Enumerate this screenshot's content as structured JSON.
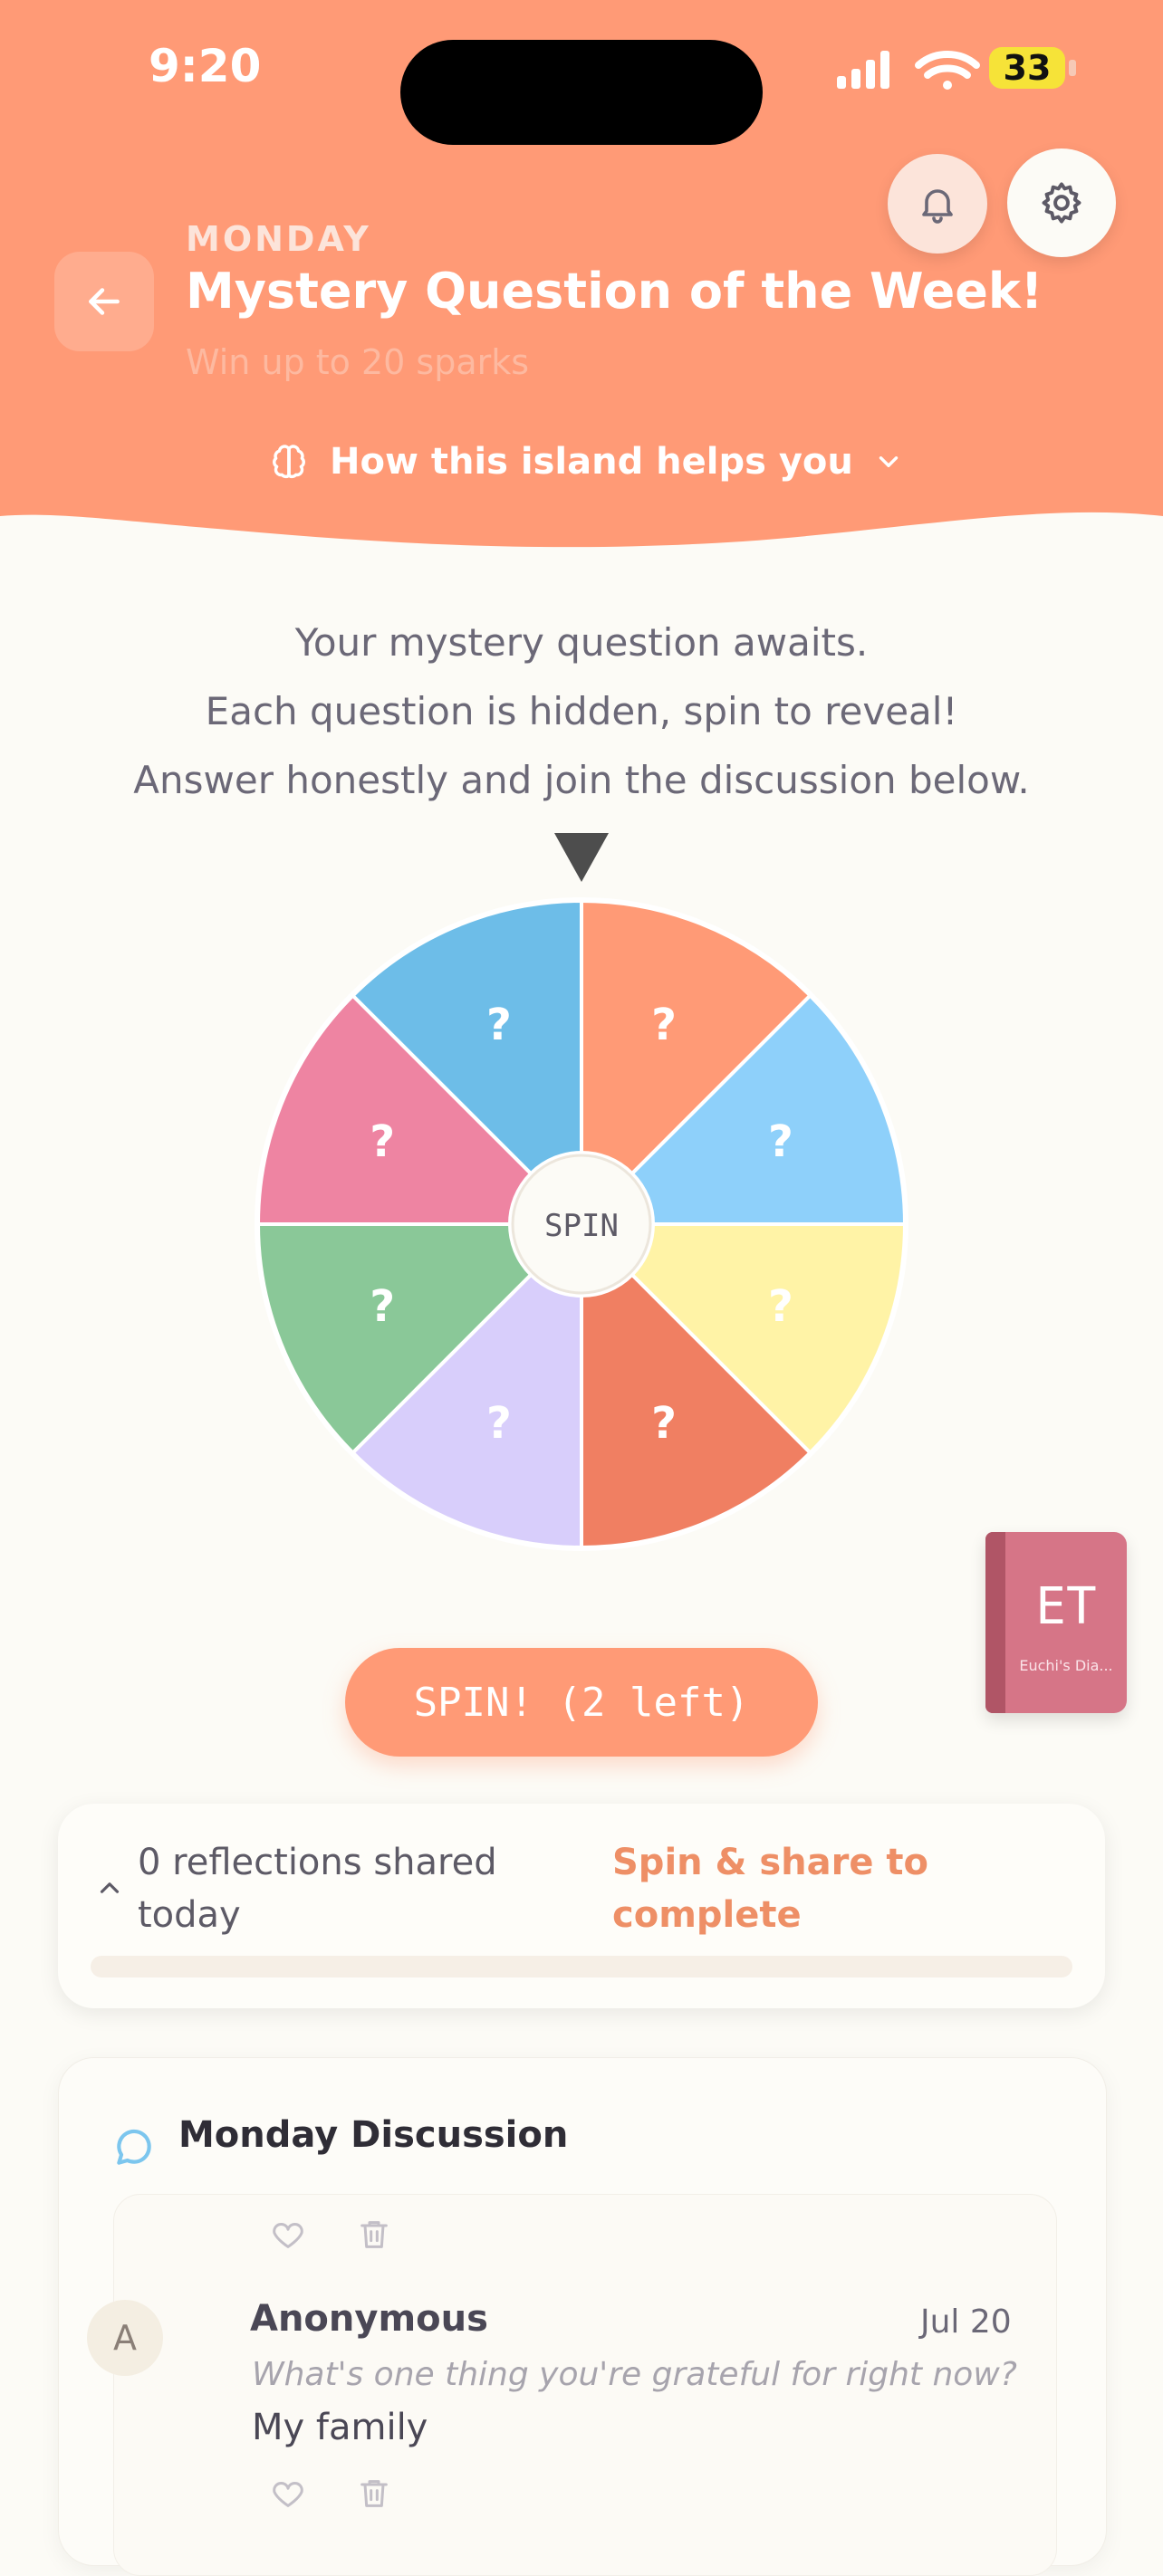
{
  "status_bar": {
    "time": "9:20",
    "battery": "33"
  },
  "header": {
    "day": "MONDAY",
    "title": "Mystery Question of the Week!",
    "subtitle": "Win up to 20 sparks",
    "helps_label": "How this island helps you",
    "accent_color": "#FF9A76"
  },
  "intro": {
    "lines": [
      "Your mystery question awaits.",
      "Each question is hidden, spin to reveal!",
      "Answer honestly and join the discussion below."
    ]
  },
  "wheel": {
    "center_label": "SPIN",
    "segments": [
      {
        "label": "?",
        "color": "#FF9A76"
      },
      {
        "label": "?",
        "color": "#8ED0FA"
      },
      {
        "label": "?",
        "color": "#FFF3A6"
      },
      {
        "label": "?",
        "color": "#F07F62"
      },
      {
        "label": "?",
        "color": "#D8CEFB"
      },
      {
        "label": "?",
        "color": "#8AC898"
      },
      {
        "label": "?",
        "color": "#EE84A2"
      },
      {
        "label": "?",
        "color": "#6DBDE8"
      }
    ]
  },
  "spin_button": {
    "label": "SPIN! (2 left)"
  },
  "book": {
    "initials": "ET",
    "name": "Euchi's Dia..."
  },
  "progress": {
    "count_text": "0 reflections shared today",
    "status_text": "Spin & share to complete",
    "fraction": 0
  },
  "discussion": {
    "title": "Monday Discussion",
    "posts": [
      {
        "avatar_letter": "A",
        "author": "Anonymous",
        "date": "Jul 20",
        "question": "What's one thing you're grateful for right now?",
        "answer": "My family"
      }
    ]
  },
  "icons": [
    "back-arrow-icon",
    "bell-icon",
    "gear-icon",
    "brain-icon",
    "chevron-down-icon",
    "chevron-up-icon",
    "chat-bubble-icon",
    "heart-icon",
    "trash-icon",
    "signal-icon",
    "wifi-icon"
  ]
}
